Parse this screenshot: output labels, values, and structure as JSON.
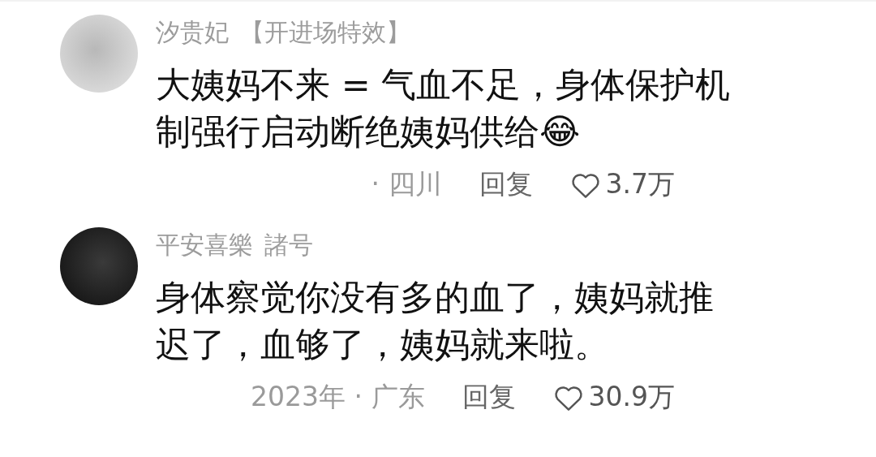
{
  "comments": [
    {
      "kind": "light",
      "username": "汐贵妃",
      "badge": "【开进场特效】",
      "text": "大姨妈不来 = 气血不足，身体保护机制强行启动断绝姨妈供给😂",
      "meta": "· 四川",
      "reply": "回复",
      "likes": "3.7万"
    },
    {
      "kind": "dark",
      "username": "平安喜樂",
      "badge": "諸号",
      "text": "身体察觉你没有多的血了，姨妈就推迟了，血够了，姨妈就来啦。",
      "meta": "2023年 · 广东",
      "reply": "回复",
      "likes": "30.9万"
    }
  ]
}
